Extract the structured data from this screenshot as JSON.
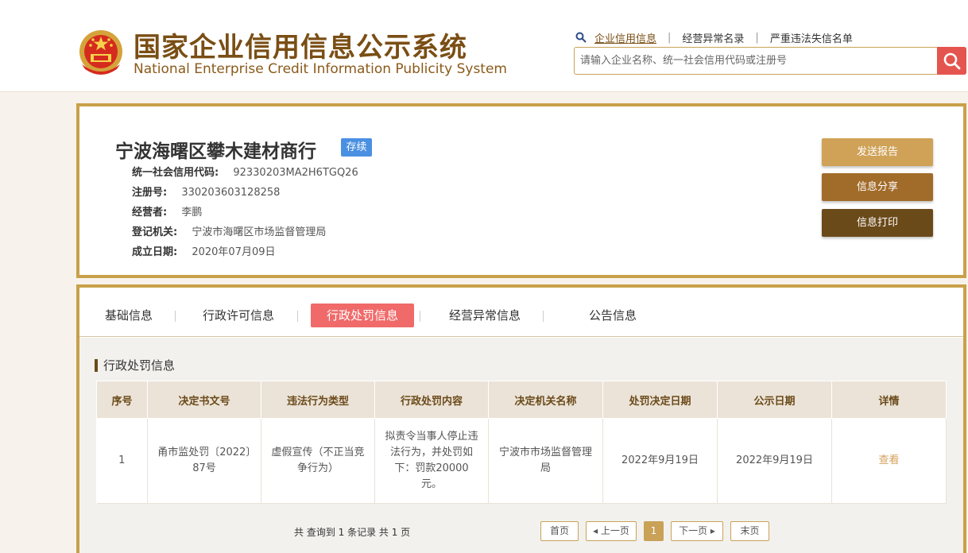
{
  "header": {
    "title_cn": "国家企业信用信息公示系统",
    "title_en": "National Enterprise Credit Information Publicity System",
    "nav": [
      "企业信用信息",
      "经营异常名录",
      "严重违法失信名单"
    ],
    "search_placeholder": "请输入企业名称、统一社会信用代码或注册号"
  },
  "company": {
    "name": "宁波海曙区攀木建材商行",
    "status": "存续",
    "fields": [
      {
        "label": "统一社会信用代码:",
        "value": "92330203MA2H6TGQ26"
      },
      {
        "label": "注册号:",
        "value": "330203603128258"
      },
      {
        "label": "经营者:",
        "value": "李鹏"
      },
      {
        "label": "登记机关:",
        "value": "宁波市海曙区市场监督管理局"
      },
      {
        "label": "成立日期:",
        "value": "2020年07月09日"
      }
    ]
  },
  "actions": {
    "report": "发送报告",
    "share": "信息分享",
    "print": "信息打印"
  },
  "tabs": [
    "基础信息",
    "行政许可信息",
    "行政处罚信息",
    "经营异常信息",
    "公告信息"
  ],
  "active_tab": "行政处罚信息",
  "section_title": "行政处罚信息",
  "table": {
    "headers": [
      "序号",
      "决定书文号",
      "违法行为类型",
      "行政处罚内容",
      "决定机关名称",
      "处罚决定日期",
      "公示日期",
      "详情"
    ],
    "rows": [
      [
        "1",
        "甬市监处罚〔2022〕87号",
        "虚假宣传（不正当竞争行为）",
        "拟责令当事人停止违法行为，并处罚如下：罚款20000元。",
        "宁波市市场监督管理局",
        "2022年9月19日",
        "2022年9月19日",
        "查看"
      ]
    ]
  },
  "pagination": {
    "summary": "共 查询到 1 条记录 共 1 页",
    "first": "首页",
    "prev": "上一页",
    "current": "1",
    "next": "下一页",
    "last": "末页"
  },
  "colors": {
    "gold_border": "#c9a04a",
    "brown_text": "#7a4e14",
    "active_tab": "#f06a6a",
    "status_badge": "#4a90e2",
    "search_button": "#e5554f"
  }
}
